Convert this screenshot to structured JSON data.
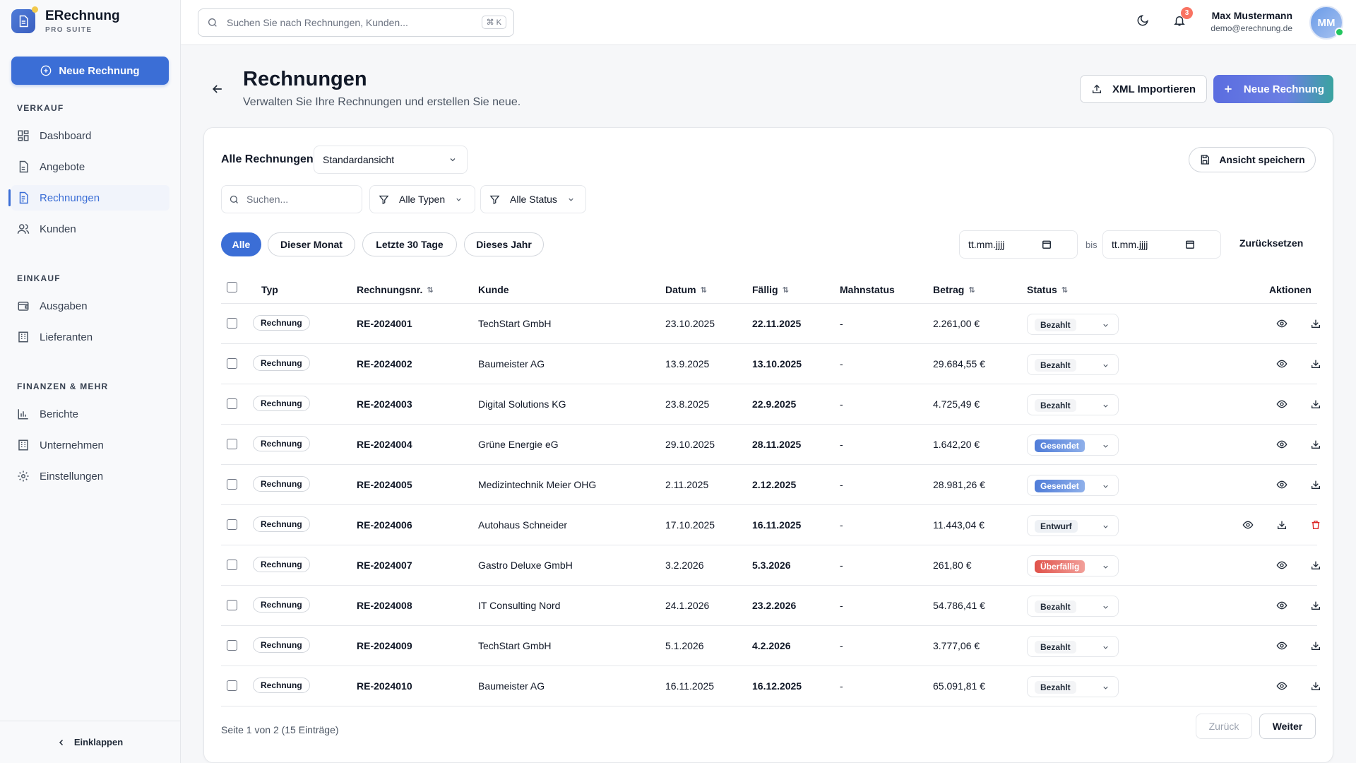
{
  "brand": {
    "title": "ERechnung",
    "subtitle": "PRO SUITE"
  },
  "sidebar": {
    "new_button": "Neue Rechnung",
    "sections": [
      {
        "title": "VERKAUF",
        "items": [
          {
            "label": "Dashboard",
            "icon": "dashboard-icon"
          },
          {
            "label": "Angebote",
            "icon": "document-icon"
          },
          {
            "label": "Rechnungen",
            "icon": "invoice-icon",
            "active": true
          },
          {
            "label": "Kunden",
            "icon": "users-icon"
          }
        ]
      },
      {
        "title": "EINKAUF",
        "items": [
          {
            "label": "Ausgaben",
            "icon": "wallet-icon"
          },
          {
            "label": "Lieferanten",
            "icon": "building-icon"
          }
        ]
      },
      {
        "title": "FINANZEN & MEHR",
        "items": [
          {
            "label": "Berichte",
            "icon": "chart-icon"
          },
          {
            "label": "Unternehmen",
            "icon": "building-icon"
          },
          {
            "label": "Einstellungen",
            "icon": "gear-icon"
          }
        ]
      }
    ],
    "collapse": "Einklappen"
  },
  "topbar": {
    "search_placeholder": "Suchen Sie nach Rechnungen, Kunden...",
    "shortcut": "⌘ K",
    "notifications": "3",
    "user_name": "Max Mustermann",
    "user_email": "demo@erechnung.de",
    "avatar_initials": "MM"
  },
  "header": {
    "title": "Rechnungen",
    "subtitle": "Verwalten Sie Ihre Rechnungen und erstellen Sie neue.",
    "import_button": "XML Importieren",
    "new_button": "Neue Rechnung"
  },
  "filters": {
    "label": "Alle Rechnungen",
    "view": "Standardansicht",
    "save_view": "Ansicht speichern",
    "search_placeholder": "Suchen...",
    "type_filter": "Alle Typen",
    "status_filter": "Alle Status",
    "pills": [
      "Alle",
      "Dieser Monat",
      "Letzte 30 Tage",
      "Dieses Jahr"
    ],
    "date_placeholder": "tt.mm.jjjj",
    "between": "bis",
    "reset": "Zurücksetzen"
  },
  "table": {
    "columns": [
      "Typ",
      "Rechnungsnr.",
      "Kunde",
      "Datum",
      "Fällig",
      "Mahnstatus",
      "Betrag",
      "Status",
      "Aktionen"
    ],
    "rows": [
      {
        "type": "Rechnung",
        "number": "RE-2024001",
        "customer": "TechStart GmbH",
        "date": "23.10.2025",
        "due": "22.11.2025",
        "dunning": "-",
        "amount": "2.261,00 €",
        "status": "Bezahlt",
        "status_kind": "paid"
      },
      {
        "type": "Rechnung",
        "number": "RE-2024002",
        "customer": "Baumeister AG",
        "date": "13.9.2025",
        "due": "13.10.2025",
        "dunning": "-",
        "amount": "29.684,55 €",
        "status": "Bezahlt",
        "status_kind": "paid"
      },
      {
        "type": "Rechnung",
        "number": "RE-2024003",
        "customer": "Digital Solutions KG",
        "date": "23.8.2025",
        "due": "22.9.2025",
        "dunning": "-",
        "amount": "4.725,49 €",
        "status": "Bezahlt",
        "status_kind": "paid"
      },
      {
        "type": "Rechnung",
        "number": "RE-2024004",
        "customer": "Grüne Energie eG",
        "date": "29.10.2025",
        "due": "28.11.2025",
        "dunning": "-",
        "amount": "1.642,20 €",
        "status": "Gesendet",
        "status_kind": "sent"
      },
      {
        "type": "Rechnung",
        "number": "RE-2024005",
        "customer": "Medizintechnik Meier OHG",
        "date": "2.11.2025",
        "due": "2.12.2025",
        "dunning": "-",
        "amount": "28.981,26 €",
        "status": "Gesendet",
        "status_kind": "sent"
      },
      {
        "type": "Rechnung",
        "number": "RE-2024006",
        "customer": "Autohaus Schneider",
        "date": "17.10.2025",
        "due": "16.11.2025",
        "dunning": "-",
        "amount": "11.443,04 €",
        "status": "Entwurf",
        "status_kind": "draft"
      },
      {
        "type": "Rechnung",
        "number": "RE-2024007",
        "customer": "Gastro Deluxe GmbH",
        "date": "3.2.2026",
        "due": "5.3.2026",
        "dunning": "-",
        "amount": "261,80 €",
        "status": "Überfällig",
        "status_kind": "overdue"
      },
      {
        "type": "Rechnung",
        "number": "RE-2024008",
        "customer": "IT Consulting Nord",
        "date": "24.1.2026",
        "due": "23.2.2026",
        "dunning": "-",
        "amount": "54.786,41 €",
        "status": "Bezahlt",
        "status_kind": "paid"
      },
      {
        "type": "Rechnung",
        "number": "RE-2024009",
        "customer": "TechStart GmbH",
        "date": "5.1.2026",
        "due": "4.2.2026",
        "dunning": "-",
        "amount": "3.777,06 €",
        "status": "Bezahlt",
        "status_kind": "paid"
      },
      {
        "type": "Rechnung",
        "number": "RE-2024010",
        "customer": "Baumeister AG",
        "date": "16.11.2025",
        "due": "16.12.2025",
        "dunning": "-",
        "amount": "65.091,81 €",
        "status": "Bezahlt",
        "status_kind": "paid"
      }
    ]
  },
  "pagination": {
    "info": "Seite 1 von 2 (15 Einträge)",
    "prev": "Zurück",
    "next": "Weiter"
  }
}
